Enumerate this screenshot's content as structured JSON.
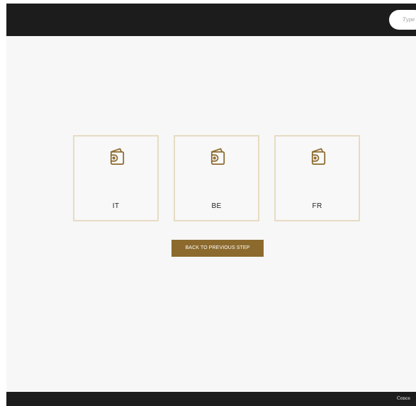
{
  "header": {
    "search": {
      "placeholder": "Type"
    }
  },
  "wallet_options": [
    {
      "label": "IT",
      "icon": "wallet-icon"
    },
    {
      "label": "BE",
      "icon": "wallet-icon"
    },
    {
      "label": "FR",
      "icon": "wallet-icon"
    }
  ],
  "actions": {
    "back_label": "BACK TO PREVIOUS STEP"
  },
  "footer": {
    "link_label": "Conce"
  },
  "colors": {
    "header_bg": "#1c1c1c",
    "page_bg": "#f7f7f7",
    "card_border": "#e6dcc3",
    "accent_gold": "#8c6a2d"
  }
}
